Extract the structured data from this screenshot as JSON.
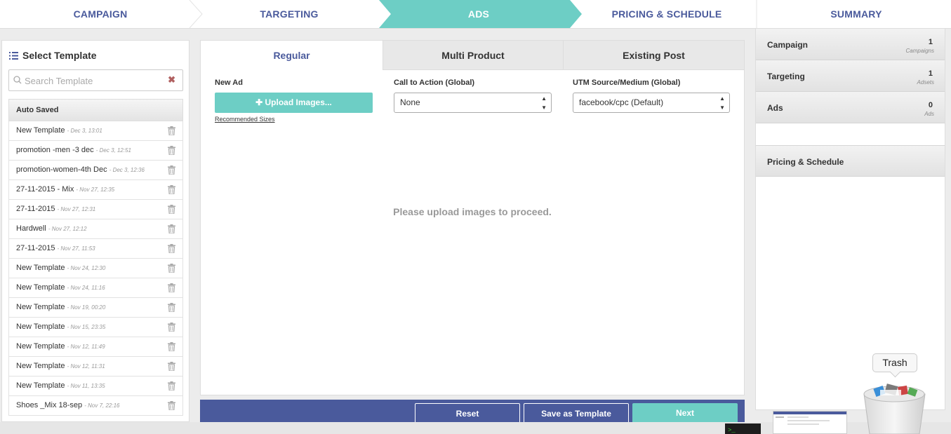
{
  "steps": [
    {
      "label": "CAMPAIGN",
      "active": false
    },
    {
      "label": "TARGETING",
      "active": false
    },
    {
      "label": "ADS",
      "active": true
    },
    {
      "label": "PRICING & SCHEDULE",
      "active": false
    },
    {
      "label": "SUMMARY",
      "active": false
    }
  ],
  "colors": {
    "accent": "#6dcec5",
    "brand": "#4a5a9c",
    "panel": "#ffffff"
  },
  "left": {
    "title": "Select Template",
    "search_placeholder": "Search Template",
    "section": "Auto Saved",
    "templates": [
      {
        "name": "New Template",
        "date": "- Dec 3, 13:01"
      },
      {
        "name": "promotion -men -3 dec",
        "date": "- Dec 3, 12:51"
      },
      {
        "name": "promotion-women-4th Dec",
        "date": "- Dec 3, 12:36"
      },
      {
        "name": "27-11-2015 - Mix",
        "date": "- Nov 27, 12:35"
      },
      {
        "name": "27-11-2015",
        "date": "- Nov 27, 12:31"
      },
      {
        "name": "Hardwell",
        "date": "- Nov 27, 12:12"
      },
      {
        "name": "27-11-2015",
        "date": "- Nov 27, 11:53"
      },
      {
        "name": "New Template",
        "date": "- Nov 24, 12:30"
      },
      {
        "name": "New Template",
        "date": "- Nov 24, 11:16"
      },
      {
        "name": "New Template",
        "date": "- Nov 19, 00:20"
      },
      {
        "name": "New Template",
        "date": "- Nov 15, 23:35"
      },
      {
        "name": "New Template",
        "date": "- Nov 12, 11:49"
      },
      {
        "name": "New Template",
        "date": "- Nov 12, 11:31"
      },
      {
        "name": "New Template",
        "date": "- Nov 11, 13:35"
      },
      {
        "name": "Shoes _Mix 18-sep",
        "date": "- Nov 7, 22:16"
      }
    ]
  },
  "tabs": [
    {
      "label": "Regular",
      "active": true
    },
    {
      "label": "Multi Product",
      "active": false
    },
    {
      "label": "Existing Post",
      "active": false
    }
  ],
  "form": {
    "new_ad_label": "New Ad",
    "upload_label": "Upload Images...",
    "recommended_label": "Recommended Sizes",
    "cta_label": "Call to Action (Global)",
    "cta_value": "None",
    "utm_label": "UTM Source/Medium (Global)",
    "utm_value": "facebook/cpc (Default)",
    "empty_message": "Please upload images to proceed."
  },
  "actions": {
    "reset": "Reset",
    "save_template": "Save as Template",
    "next": "Next"
  },
  "summary": [
    {
      "label": "Campaign",
      "count": "1",
      "unit": "Campaigns"
    },
    {
      "label": "Targeting",
      "count": "1",
      "unit": "Adsets"
    },
    {
      "label": "Ads",
      "count": "0",
      "unit": "Ads"
    },
    {
      "label": "Pricing & Schedule",
      "count": "",
      "unit": ""
    }
  ],
  "dock": {
    "tooltip": "Trash"
  }
}
